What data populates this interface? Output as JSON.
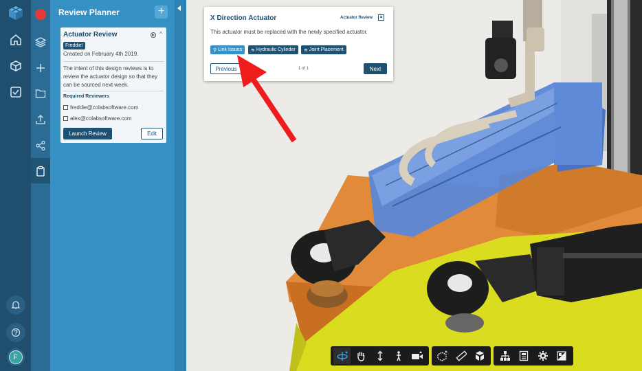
{
  "panel": {
    "title": "Review Planner",
    "add_label": "+"
  },
  "review_card": {
    "title": "Actuator Review",
    "badge": "Freddie!",
    "created": "Created on February 4th 2019.",
    "description": "The intent of this design reviews is to review the actuator design so that they can be sourced next week.",
    "required_label": "Required Reviewers",
    "reviewers": [
      "freddie@colabsoftware.com",
      "alex@colabsoftware.com"
    ],
    "launch_label": "Launch Review",
    "edit_label": "Edit"
  },
  "popup": {
    "title": "X Direction Actuator",
    "tag": "Actuator Review",
    "close_label": "×",
    "description": "This actuator must be replaced with the newly specified actuator.",
    "chips": [
      "Link Issues",
      "Hydraulic Cylinder",
      "Joint Placement"
    ],
    "previous_label": "Previous",
    "page_indicator": "1 of 1",
    "next_label": "Next"
  },
  "user": {
    "avatar_initial": "F"
  },
  "colors": {
    "rail": "#1f4e6e",
    "panel": "#3591c4",
    "accent_dark": "#1f5272",
    "record_red": "#e53935",
    "arrow_red": "#ee1c1c"
  },
  "toolbar": {
    "icons": [
      "orbit-icon",
      "pan-hand-icon",
      "zoom-icon",
      "walk-person-icon",
      "camera-icon",
      "section-box-icon",
      "measure-ruler-icon",
      "explode-cube-icon",
      "tree-structure-icon",
      "properties-icon",
      "settings-gear-icon",
      "render-mode-icon"
    ]
  }
}
